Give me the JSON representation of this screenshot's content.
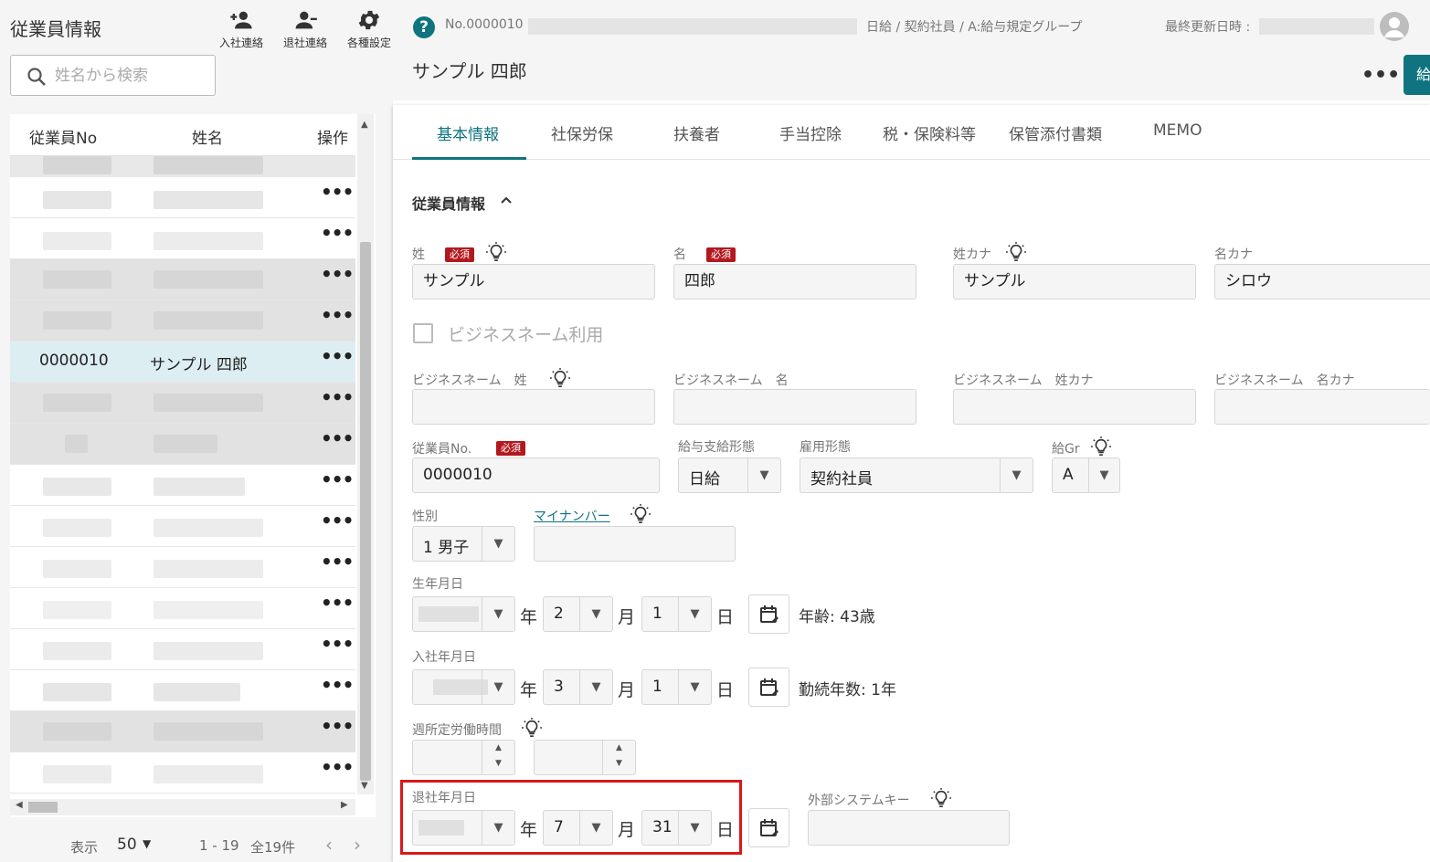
{
  "sidebar": {
    "title": "従業員情報",
    "tools": [
      {
        "label": "入社連絡",
        "icon": "person-add-icon"
      },
      {
        "label": "退社連絡",
        "icon": "person-remove-icon"
      },
      {
        "label": "各種設定",
        "icon": "gear-icon"
      }
    ],
    "search": {
      "placeholder": "姓名から検索"
    },
    "table": {
      "headers": [
        "従業員No",
        "姓名",
        "操作"
      ],
      "selected_row": {
        "no": "0000010",
        "name": "サンプル 四郎"
      },
      "action": "•••"
    },
    "pager": {
      "show_label": "表示",
      "per_page": "50",
      "range": "1 - 19",
      "total": "全19件"
    }
  },
  "header": {
    "employee_id": "No.0000010",
    "meta": "日給 / 契約社員 / A:給与規定グループ",
    "updated_label": "最終更新日時 :",
    "employee_name": "サンプル 四郎",
    "more": "•••",
    "save_label": "給"
  },
  "tabs": [
    "基本情報",
    "社保労保",
    "扶養者",
    "手当控除",
    "税・保険料等",
    "保管添付書類",
    "MEMO"
  ],
  "section": {
    "title": "従業員情報"
  },
  "form": {
    "required_badge": "必須",
    "last_name": {
      "label": "姓",
      "value": "サンプル"
    },
    "first_name": {
      "label": "名",
      "value": "四郎"
    },
    "last_kana": {
      "label": "姓カナ",
      "value": "サンプル"
    },
    "first_kana": {
      "label": "名カナ",
      "value": "シロウ"
    },
    "business_name_checkbox": "ビジネスネーム利用",
    "bn_last": {
      "label": "ビジネスネーム　姓"
    },
    "bn_first": {
      "label": "ビジネスネーム　名"
    },
    "bn_last_kana": {
      "label": "ビジネスネーム　姓カナ"
    },
    "bn_first_kana": {
      "label": "ビジネスネーム　名カナ"
    },
    "employee_no": {
      "label": "従業員No.",
      "value": "0000010"
    },
    "pay_type": {
      "label": "給与支給形態",
      "value": "日給"
    },
    "employment_type": {
      "label": "雇用形態",
      "value": "契約社員"
    },
    "pay_group": {
      "label": "給Gr",
      "value": "A"
    },
    "gender": {
      "label": "性別",
      "value": "1 男子"
    },
    "my_number": {
      "label": "マイナンバー"
    },
    "birth": {
      "label": "生年月日",
      "month": "2",
      "day": "1",
      "info": "年齢: 43歳"
    },
    "hire": {
      "label": "入社年月日",
      "month": "3",
      "day": "1",
      "info": "勤続年数: 1年"
    },
    "weekly_hours": {
      "label": "週所定労働時間"
    },
    "retire": {
      "label": "退社年月日",
      "month": "7",
      "day": "31"
    },
    "external_key": {
      "label": "外部システムキー"
    },
    "units": {
      "year": "年",
      "month": "月",
      "day": "日"
    }
  },
  "colors": {
    "accent": "#0f7480",
    "required": "#b3181f",
    "highlight": "#d81919",
    "selected_row": "#ddeef2"
  }
}
